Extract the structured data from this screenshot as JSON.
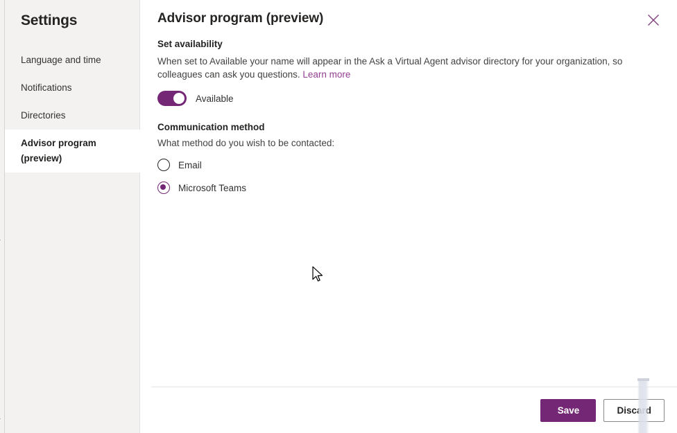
{
  "app_rail": {
    "icons": [
      "chevron-icon",
      "circle-icon",
      "bar-icon",
      "dot-icon",
      "line-icon",
      "bracket-icon",
      "tick-icon"
    ]
  },
  "sidebar": {
    "title": "Settings",
    "items": [
      {
        "label": "Language and time",
        "selected": false
      },
      {
        "label": "Notifications",
        "selected": false
      },
      {
        "label": "Directories",
        "selected": false
      },
      {
        "label": "Advisor program (preview)",
        "selected": true
      }
    ]
  },
  "panel": {
    "title": "Advisor program (preview)",
    "close_icon": "close-icon",
    "availability": {
      "heading": "Set availability",
      "description_before_link": "When set to Available your name will appear in the Ask a Virtual Agent advisor directory for your organization, so colleagues can ask you questions. ",
      "link_label": "Learn more",
      "toggle_label": "Available",
      "toggle_on": true
    },
    "communication": {
      "heading": "Communication method",
      "description": "What method do you wish to be contacted:",
      "options": [
        {
          "label": "Email",
          "selected": false
        },
        {
          "label": "Microsoft Teams",
          "selected": true
        }
      ]
    },
    "footer": {
      "save_label": "Save",
      "discard_label": "Discard"
    }
  },
  "theme": {
    "accent": "#742774",
    "link": "#923f92",
    "sidebar_bg": "#f3f2f1",
    "panel_bg": "#ffffff",
    "text": "#323130"
  }
}
